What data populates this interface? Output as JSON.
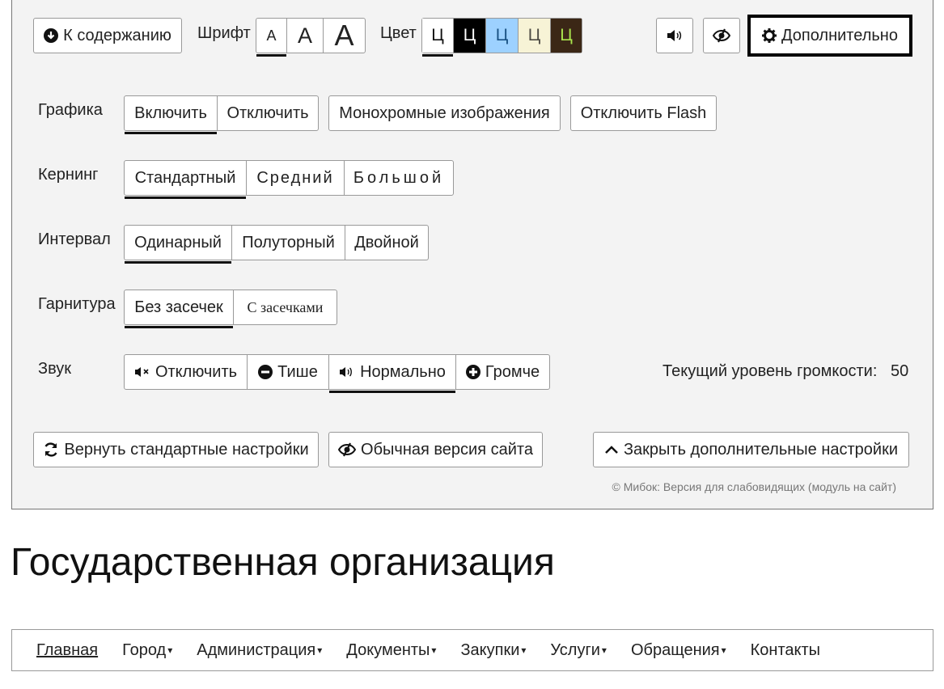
{
  "toolbar": {
    "to_content": "К содержанию",
    "font_label": "Шрифт",
    "font_sizes": [
      "A",
      "A",
      "A"
    ],
    "color_label": "Цвет",
    "color_swatches": [
      {
        "text": "Ц",
        "bg": "#ffffff",
        "fg": "#111111"
      },
      {
        "text": "Ц",
        "bg": "#000000",
        "fg": "#ffffff"
      },
      {
        "text": "Ц",
        "bg": "#9dd1ff",
        "fg": "#195183"
      },
      {
        "text": "Ц",
        "bg": "#f7f3d6",
        "fg": "#4d4b43"
      },
      {
        "text": "Ц",
        "bg": "#3b2716",
        "fg": "#a9e44d"
      }
    ],
    "more": "Дополнительно"
  },
  "settings": {
    "graphics": {
      "label": "Графика",
      "on": "Включить",
      "off": "Отключить",
      "mono": "Монохромные изображения",
      "flash": "Отключить Flash"
    },
    "kerning": {
      "label": "Кернинг",
      "options": [
        "Стандартный",
        "Средний",
        "Большой"
      ]
    },
    "interval": {
      "label": "Интервал",
      "options": [
        "Одинарный",
        "Полуторный",
        "Двойной"
      ]
    },
    "typeface": {
      "label": "Гарнитура",
      "options": [
        "Без засечек",
        "С засечками"
      ]
    },
    "sound": {
      "label": "Звук",
      "off": "Отключить",
      "quieter": "Тише",
      "normal": "Нормально",
      "louder": "Громче",
      "volume_label": "Текущий уровень громкости:",
      "volume_value": "50"
    }
  },
  "actions": {
    "reset": "Вернуть стандартные настройки",
    "normal_site": "Обычная версия сайта",
    "close_more": "Закрыть дополнительные настройки"
  },
  "copyright": "© Мибок: Версия для слабовидящих (модуль на сайт)",
  "page_title": "Государственная организация",
  "nav": [
    {
      "label": "Главная"
    },
    {
      "label": "Город"
    },
    {
      "label": "Администрация"
    },
    {
      "label": "Документы"
    },
    {
      "label": "Закупки"
    },
    {
      "label": "Услуги"
    },
    {
      "label": "Обращения"
    },
    {
      "label": "Контакты"
    }
  ]
}
